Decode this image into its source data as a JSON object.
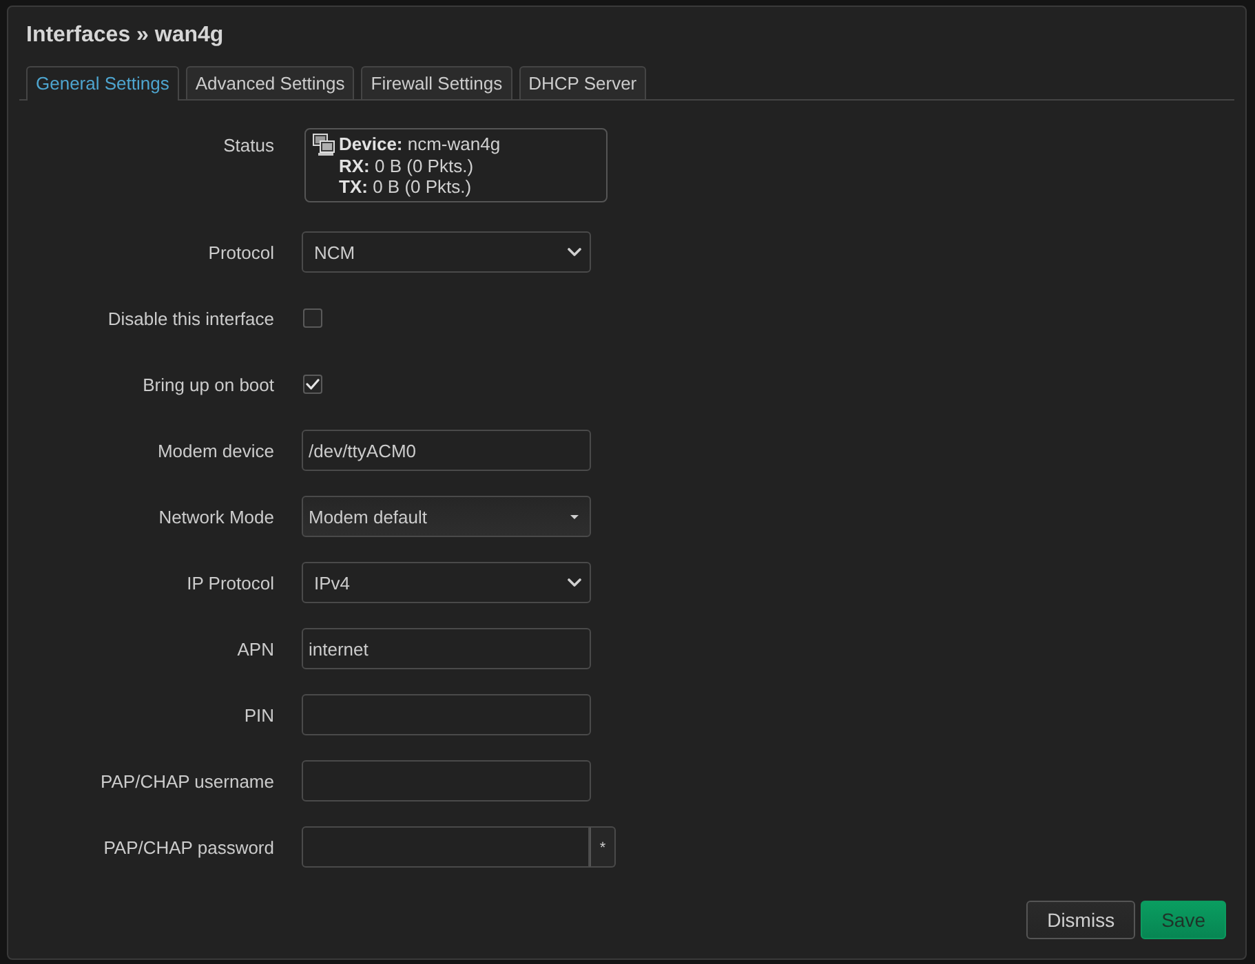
{
  "dialog": {
    "title": "Interfaces » wan4g",
    "tabs": [
      {
        "label": "General Settings",
        "selected": true
      },
      {
        "label": "Advanced Settings",
        "selected": false
      },
      {
        "label": "Firewall Settings",
        "selected": false
      },
      {
        "label": "DHCP Server",
        "selected": false
      }
    ],
    "fields": [
      {
        "kind": "status",
        "label": "Status",
        "lines": [
          "**Device:** ncm-wan4g",
          "**RX:** 0 B (0 Pkts.)",
          "**TX:** 0 B (0 Pkts.)"
        ]
      },
      {
        "kind": "select",
        "label": "Protocol",
        "value": "NCM"
      },
      {
        "kind": "checkbox",
        "label": "Disable this interface",
        "checked": false
      },
      {
        "kind": "checkbox",
        "label": "Bring up on boot",
        "checked": true
      },
      {
        "kind": "text",
        "label": "Modem device",
        "value": "/dev/ttyACM0"
      },
      {
        "kind": "dropdown",
        "label": "Network Mode",
        "value": "Modem default"
      },
      {
        "kind": "select",
        "label": "IP Protocol",
        "value": "IPv4"
      },
      {
        "kind": "text",
        "label": "APN",
        "value": "internet"
      },
      {
        "kind": "text",
        "label": "PIN"
      },
      {
        "kind": "text",
        "label": "PAP/CHAP username"
      },
      {
        "kind": "password",
        "label": "PAP/CHAP password",
        "reveal_label": "*"
      }
    ],
    "buttons": [
      {
        "label": "Dismiss",
        "kind": "secondary"
      },
      {
        "label": "Save",
        "kind": "primary"
      }
    ]
  }
}
